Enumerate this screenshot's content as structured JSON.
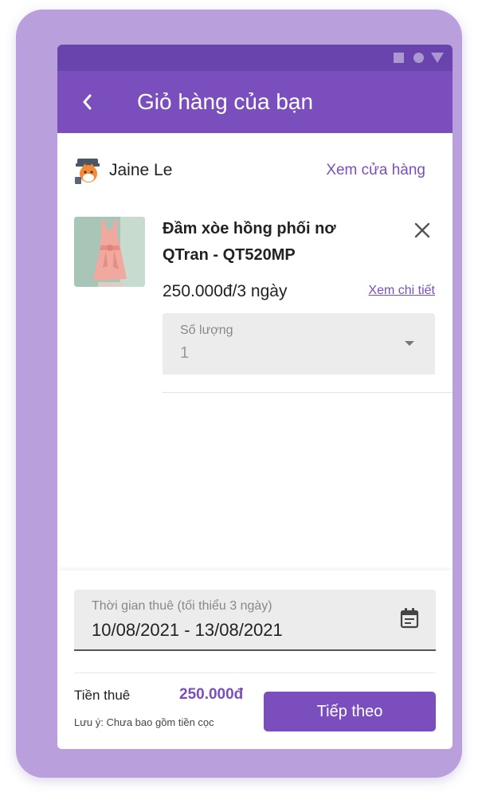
{
  "header": {
    "title": "Giỏ hàng của bạn"
  },
  "shop": {
    "name": "Jaine Le",
    "link_label": "Xem cửa hàng"
  },
  "product": {
    "name_line1": "Đầm xòe hồng phối nơ",
    "name_line2": "QTran - QT520MP",
    "price": "250.000đ/3 ngày",
    "detail_link": "Xem chi tiết"
  },
  "quantity": {
    "label": "Số lượng",
    "value": "1"
  },
  "rental": {
    "period_label": "Thời gian thuê (tối thiểu 3 ngày)",
    "period_value": "10/08/2021 - 13/08/2021",
    "fee_label": "Tiền thuê",
    "fee_value": "250.000đ",
    "note": "Lưu ý: Chưa bao gồm tiền cọc"
  },
  "actions": {
    "next_label": "Tiếp theo"
  },
  "colors": {
    "primary": "#7a4fbd",
    "statusbar": "#6a44ad",
    "frame": "#b9a0dd"
  },
  "icons": [
    "back-icon",
    "shop-avatar-icon",
    "close-icon",
    "dropdown-caret-icon",
    "calendar-icon"
  ]
}
